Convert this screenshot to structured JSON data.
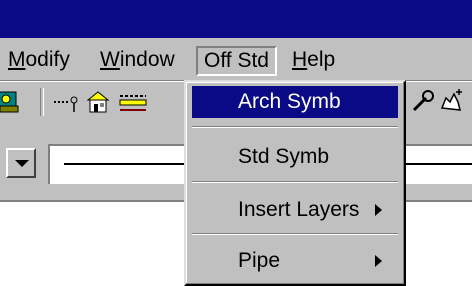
{
  "menubar": {
    "items": [
      {
        "label": "Modify",
        "mnemonic": "M"
      },
      {
        "label": "Window",
        "mnemonic": "W"
      },
      {
        "label": "Off Std",
        "mnemonic": ""
      },
      {
        "label": "Help",
        "mnemonic": "H"
      }
    ]
  },
  "popup": {
    "items": [
      {
        "label": "Arch Symb",
        "has_submenu": false
      },
      {
        "label": "Std Symb",
        "has_submenu": false
      },
      {
        "label": "Insert Layers",
        "has_submenu": true
      },
      {
        "label": "Pipe",
        "has_submenu": true
      }
    ]
  },
  "toolbar": {
    "icons": [
      "network-icon",
      "polyline-icon",
      "building-icon",
      "layer-lines-icon",
      "wrench-icon",
      "pointer-hand-icon"
    ]
  },
  "colors": {
    "titlebar": "#0a0a86",
    "highlight": "#0a0a86",
    "face": "#c0c0c0"
  }
}
